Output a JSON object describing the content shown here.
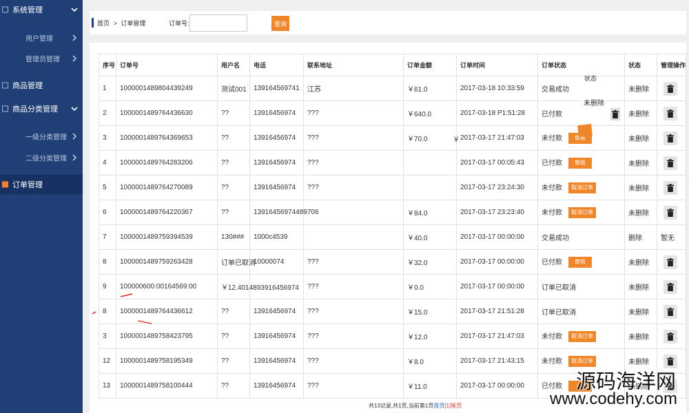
{
  "colors": {
    "sidebar": "#1f3f76",
    "accent": "#f0862a",
    "background": "#efefef"
  },
  "sidebar": {
    "items": [
      {
        "label": "系统管理"
      },
      {
        "label": "用户管理"
      },
      {
        "label": "管理员管理"
      },
      {
        "label": "商品管理"
      },
      {
        "label": "商品分类管理"
      },
      {
        "label": "一级分类管理"
      },
      {
        "label": "二级分类管理"
      },
      {
        "label": "订单管理",
        "active": true
      }
    ]
  },
  "breadcrumb": {
    "home": "首页",
    "separator": ">",
    "current": "订单管理"
  },
  "search": {
    "label": "订单号:",
    "value": "",
    "button": "查询"
  },
  "table": {
    "columns": [
      "序号",
      "订单号",
      "用户名",
      "电话",
      "联系地址",
      "订单金额",
      "订单时间",
      "订单状态",
      "状态",
      "管理操作"
    ],
    "rows": [
      {
        "no": "1",
        "order_no": "1000001489804439249",
        "username": "测试001",
        "phone": "139164569741",
        "address": "江苏",
        "amount": "￥61.0",
        "time": "2017-03-18 10:33:59",
        "order_status": "交易成功",
        "delete_status": "未删除",
        "operation_icon": "trash-icon"
      },
      {
        "no": "2",
        "order_no": "1000001489764436630",
        "username": "??",
        "phone": "13916456974",
        "address": "???",
        "amount": "￥640.0",
        "time": "2017-03-18 P1:51:28",
        "order_status": "已付款",
        "delete_status": "未删除",
        "operation_icon": "trash-icon"
      },
      {
        "no": "3",
        "order_no": "1000001489764369653",
        "username": "??",
        "phone": "13916456974",
        "address": "???",
        "amount": "￥70.0",
        "time": "2017-03-17 21:47:03",
        "order_status": "未付款",
        "action_button": "审核",
        "delete_status": "未删除",
        "operation_icon": "trash-icon"
      },
      {
        "no": "4",
        "order_no": "1000001489764283206",
        "username": "??",
        "phone": "13916456974",
        "address": "???",
        "time": "2017-03-17 00:05:43",
        "order_status": "已付款",
        "action_button": "审核",
        "delete_status": "未删除",
        "operation_icon": "trash-icon"
      },
      {
        "no": "5",
        "order_no": "1000001489764270089",
        "username": "??",
        "phone": "13916456974",
        "address": "???",
        "time": "2017-03-17 23:24:30",
        "order_status": "未付款",
        "action_button": "取消订单",
        "delete_status": "未删除",
        "operation_icon": "trash-icon"
      },
      {
        "no": "6",
        "order_no": "1000001489764220367",
        "username": "??",
        "phone": "13916456974489706",
        "amount": "￥84.0",
        "time": "2017-03-17 23:23:40",
        "order_status": "未付款",
        "action_button": "取消订单",
        "delete_status": "未删除",
        "operation_icon": "trash-icon"
      },
      {
        "no": "7",
        "order_no": "1000001489759394539",
        "username": "130###",
        "phone": "1000c4539",
        "amount": "￥40.0",
        "time": "2017-03-17 00:00:00",
        "order_status": "交易成功",
        "delete_status": "删除",
        "operation_text": "暂无"
      },
      {
        "no": "8",
        "order_no": "1000001489759263428",
        "username": "订单已取消",
        "phone": "10000074",
        "address": "???",
        "amount": "￥32.0",
        "time": "2017-03-17 00:00:00",
        "order_status": "已付款",
        "action_button": "审核",
        "delete_status": "未删除",
        "operation_icon": "trash-icon"
      },
      {
        "no": "9",
        "order_no": "100000600:00164569:00",
        "username": "￥12.4014893916456974",
        "address": "???",
        "amount": "￥0.0",
        "time": "2017-03-17 00:00:00",
        "order_status": "订单已取消",
        "delete_status": "未删除",
        "operation_icon": "trash-icon"
      },
      {
        "no": "8",
        "order_no": "1000001489764436612",
        "username": "??",
        "phone": "13916456974",
        "address": "???",
        "amount": "￥15.0",
        "time": "2017-03-17 21:51:28",
        "order_status": "订单已取消",
        "delete_status": "未删除",
        "operation_icon": "trash-icon"
      },
      {
        "no": "3",
        "order_no": "1000001489758423795",
        "username": "??",
        "phone": "13916456974",
        "address": "???",
        "amount": "￥12.0",
        "time": "2017-03-17 21:47:03",
        "order_status": "未付款",
        "action_button": "取消订单",
        "delete_status": "未删除",
        "operation_icon": "trash-icon"
      },
      {
        "no": "12",
        "order_no": "1000001489758195349",
        "username": "??",
        "phone": "13916456974",
        "address": "???",
        "amount": "￥8.0",
        "time": "2017-03-17 21:43:15",
        "order_status": "未付款",
        "action_button": "取消订单",
        "delete_status": "未删除",
        "operation_icon": "trash-icon"
      },
      {
        "no": "13",
        "order_no": "1000001489758100444",
        "username": "??",
        "phone": "13916456974",
        "address": "???",
        "amount": "￥11.0",
        "time": "2017-03-17 00:00:00",
        "order_status": "已付款",
        "action_button": "",
        "delete_status": "未删除",
        "operation_icon": "trash-icon"
      }
    ]
  },
  "pagination": {
    "summary": "共13记录,共1页,当前第1页",
    "first": "首页",
    "current": "[1]",
    "last": "尾页"
  },
  "overlay": {
    "status_label": "状态",
    "delete_status": "未删除",
    "currency": "￥"
  },
  "watermark": {
    "name": "源码海洋网",
    "url": "www.codehy.com"
  }
}
